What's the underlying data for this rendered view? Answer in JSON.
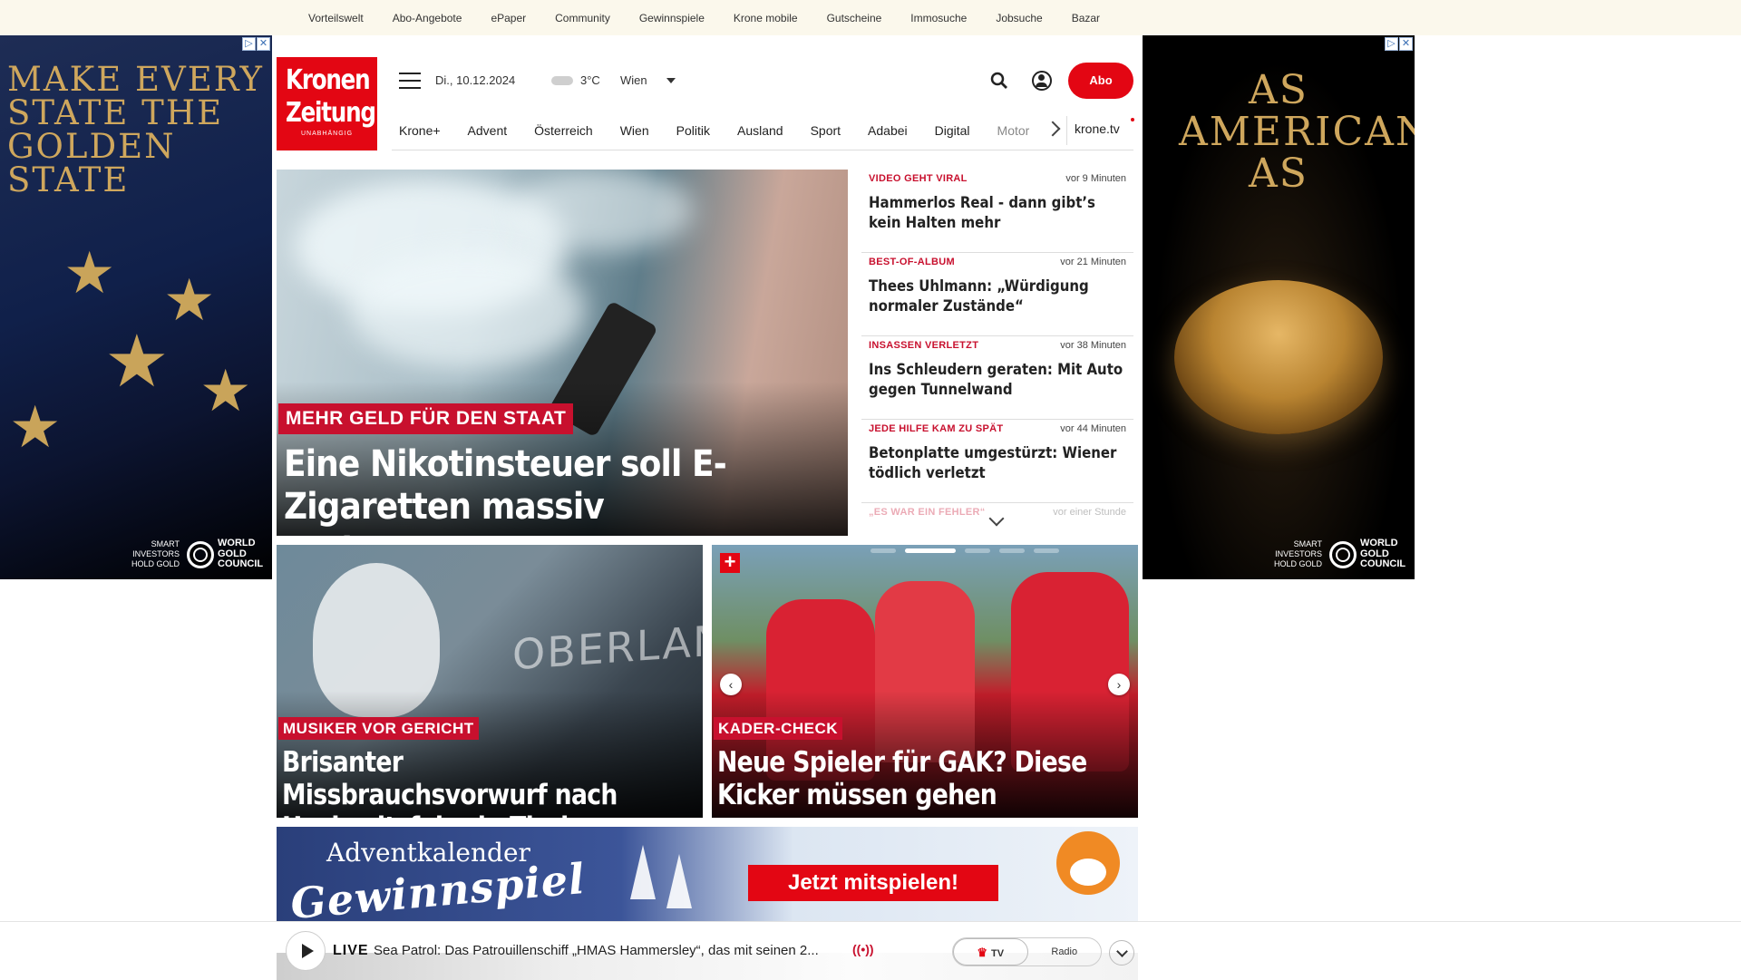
{
  "topbar": {
    "items": [
      "Vorteilswelt",
      "Abo-Angebote",
      "ePaper",
      "Community",
      "Gewinnspiele",
      "Krone mobile",
      "Gutscheine",
      "Immosuche",
      "Jobsuche",
      "Bazar"
    ]
  },
  "ad_left": {
    "headline": "MAKE EVERY STATE THE GOLDEN STATE",
    "tagline": "SMART INVESTORS HOLD GOLD",
    "brand": "WORLD GOLD COUNCIL"
  },
  "ad_right": {
    "headline": "AS AMERICAN AS",
    "tagline": "SMART INVESTORS HOLD GOLD",
    "brand": "WORLD GOLD COUNCIL"
  },
  "header": {
    "logo_line1": "Kronen",
    "logo_line2": "Zeitung",
    "logo_sub": "UNABHÄNGIG",
    "date": "Di., 10.12.2024",
    "temperature": "3°C",
    "city": "Wien",
    "abo_label": "Abo"
  },
  "nav": {
    "items": [
      "Krone+",
      "Advent",
      "Österreich",
      "Wien",
      "Politik",
      "Ausland",
      "Sport",
      "Adabei",
      "Digital",
      "Motor"
    ],
    "tv_label": "krone.tv"
  },
  "hero": {
    "kicker": "MEHR GELD FÜR DEN STAAT",
    "headline": "Eine Nikotinsteuer soll E-Zigaretten massiv verteuern"
  },
  "ticker": [
    {
      "tag": "VIDEO GEHT VIRAL",
      "time": "vor 9 Minuten",
      "title": "Hammerlos Real - dann gibt’s kein Halten mehr"
    },
    {
      "tag": "BEST-OF-ALBUM",
      "time": "vor 21 Minuten",
      "title": "Thees Uhlmann: „Würdigung normaler Zustände“"
    },
    {
      "tag": "INSASSEN VERLETZT",
      "time": "vor 38 Minuten",
      "title": "Ins Schleudern geraten: Mit Auto gegen Tunnelwand"
    },
    {
      "tag": "JEDE HILFE KAM ZU SPÄT",
      "time": "vor 44 Minuten",
      "title": "Betonplatte umgestürzt: Wiener tödlich verletzt"
    },
    {
      "tag": "„ES WAR EIN FEHLER“",
      "time": "vor einer Stunde",
      "title": ""
    }
  ],
  "card1": {
    "kicker": "MUSIKER VOR GERICHT",
    "headline": "Brisanter Missbrauchsvorwurf nach Hochzeitsfeier in Tirol",
    "image_text": "OBERLANDESGERICHT"
  },
  "card2": {
    "kicker": "KADER-CHECK",
    "headline": "Neue Spieler für GAK? Diese Kicker müssen gehen"
  },
  "banner": {
    "line1": "Adventkalender",
    "line2": "Gewinnspiel",
    "cta": "Jetzt mitspielen!"
  },
  "player": {
    "live_label": "LIVE",
    "title": "Sea Patrol: Das Patrouillenschiff „HMAS Hammersley“, das mit seinen 2...",
    "tv_label": "TV",
    "radio_label": "Radio"
  },
  "colors": {
    "brand_red": "#e30613",
    "kicker_red": "#c8102e",
    "topbar_bg": "#fbf8ec"
  }
}
